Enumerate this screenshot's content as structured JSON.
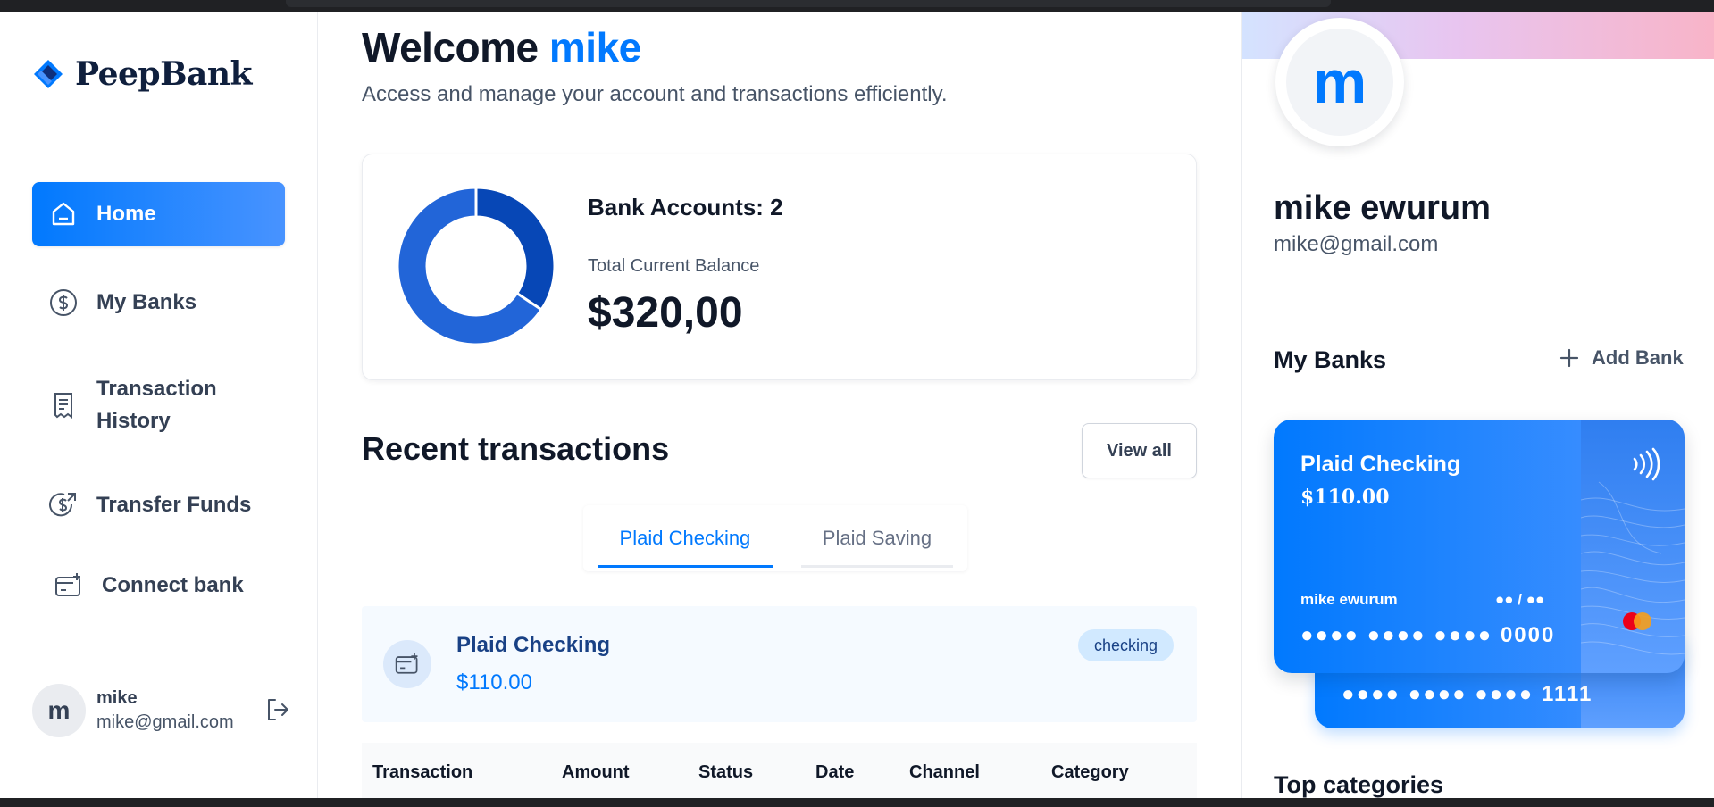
{
  "brand": {
    "name": "PeepBank"
  },
  "nav": {
    "items": [
      {
        "label": "Home",
        "icon": "home-icon",
        "active": true
      },
      {
        "label": "My Banks",
        "icon": "dollar-circle-icon",
        "active": false
      },
      {
        "label": "Transaction",
        "label2": "History",
        "icon": "receipt-icon",
        "active": false
      },
      {
        "label": "Transfer Funds",
        "icon": "money-send-icon",
        "active": false
      },
      {
        "label": "Connect bank",
        "icon": "connect-bank-icon",
        "active": false
      }
    ]
  },
  "footer_user": {
    "initial": "m",
    "name": "mike",
    "email": "mike@gmail.com",
    "logout_icon": "logout-icon"
  },
  "header": {
    "welcome_prefix": "Welcome",
    "user_name": "mike",
    "subtitle": "Access and manage your account and transactions efficiently."
  },
  "balance": {
    "accounts_label": "Bank Accounts: 2",
    "total_label": "Total Current Balance",
    "total_value": "$320,00",
    "donut": [
      {
        "name": "Plaid Checking",
        "value": 110,
        "color": "#0747b6"
      },
      {
        "name": "Plaid Saving",
        "value": 210,
        "color": "#2265d8"
      }
    ]
  },
  "recent": {
    "title": "Recent transactions",
    "view_all": "View all",
    "tabs": [
      "Plaid Checking",
      "Plaid Saving"
    ],
    "selected_bank": {
      "name": "Plaid Checking",
      "amount": "$110.00",
      "badge": "checking"
    },
    "columns": [
      "Transaction",
      "Amount",
      "Status",
      "Date",
      "Channel",
      "Category"
    ]
  },
  "profile": {
    "initial": "m",
    "name": "mike ewurum",
    "email": "mike@gmail.com"
  },
  "my_banks": {
    "title": "My Banks",
    "add_label": "Add Bank",
    "cards": [
      {
        "bank": "Plaid Checking",
        "balance": "$110.00",
        "owner": "mike ewurum",
        "expiry": "●● / ●●",
        "number": "●●●● ●●●● ●●●● 0000"
      },
      {
        "number": "●●●● ●●●● ●●●● 1111"
      }
    ]
  },
  "top_categories": {
    "title": "Top categories"
  },
  "colors": {
    "primary": "#0179fe",
    "text": "#101828",
    "muted": "#475467"
  }
}
